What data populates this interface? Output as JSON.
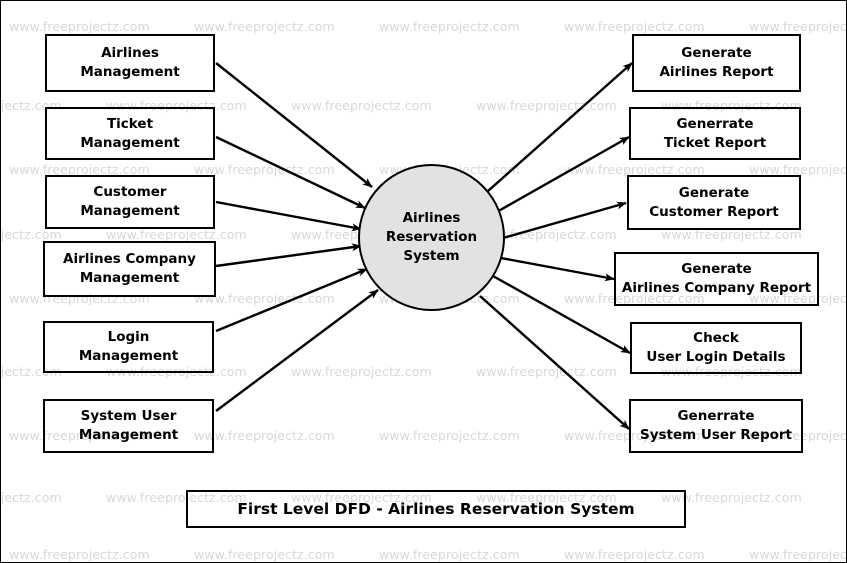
{
  "diagram": {
    "title": "First Level DFD - Airlines Reservation System",
    "process": {
      "label": "Airlines\nReservation\nSystem",
      "fill": "#e2e2e2",
      "stroke": "#000000"
    },
    "inputs": [
      {
        "label": "Airlines\nManagement"
      },
      {
        "label": "Ticket\nManagement"
      },
      {
        "label": "Customer\nManagement"
      },
      {
        "label": "Airlines Company\nManagement"
      },
      {
        "label": "Login\nManagement"
      },
      {
        "label": "System User\nManagement"
      }
    ],
    "outputs": [
      {
        "label": "Generate\nAirlines Report"
      },
      {
        "label": "Generrate\nTicket Report"
      },
      {
        "label": "Generate\nCustomer Report"
      },
      {
        "label": "Generate\nAirlines Company Report"
      },
      {
        "label": "Check\nUser Login Details"
      },
      {
        "label": "Generrate\nSystem User Report"
      }
    ]
  },
  "watermark": {
    "text": "www.freeprojectz.com",
    "color": "#d8d8d8"
  }
}
